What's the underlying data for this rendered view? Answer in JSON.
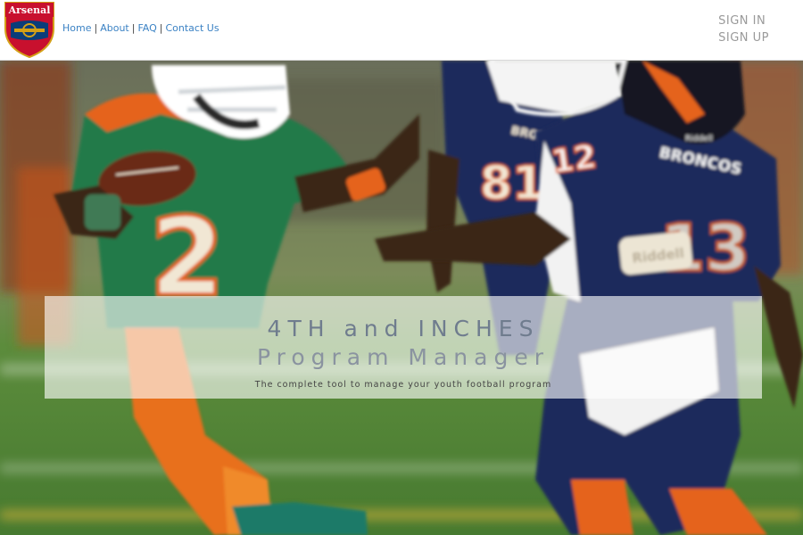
{
  "header": {
    "logo_text": "Arsenal",
    "nav": [
      {
        "label": "Home"
      },
      {
        "label": "About"
      },
      {
        "label": "FAQ"
      },
      {
        "label": "Contact Us"
      }
    ],
    "nav_separator": "|",
    "auth": {
      "sign_in": "SIGN IN",
      "sign_up": "SIGN UP"
    }
  },
  "hero": {
    "image_description_icon": "football-players-photo",
    "left_jersey_number": "2",
    "right_jersey_number": "12",
    "right_team_name": "BRONCOS",
    "back_jersey_number": "81",
    "back_team_name": "BRONCOS",
    "belt_brand": "Riddell",
    "helmet_brand": "Riddell"
  },
  "banner": {
    "title": "4TH and INCHES",
    "subtitle": "Program Manager",
    "tagline": "The complete tool to manage your youth football program"
  },
  "colors": {
    "nav_link": "#3b82c4",
    "auth_text": "#9a9a9a",
    "title_text": "#6f7c8e",
    "green_jersey": "#1f6b45",
    "orange_accent": "#e5641e",
    "navy_jersey": "#1e2a5c",
    "field_green": "#4f8a3a"
  }
}
